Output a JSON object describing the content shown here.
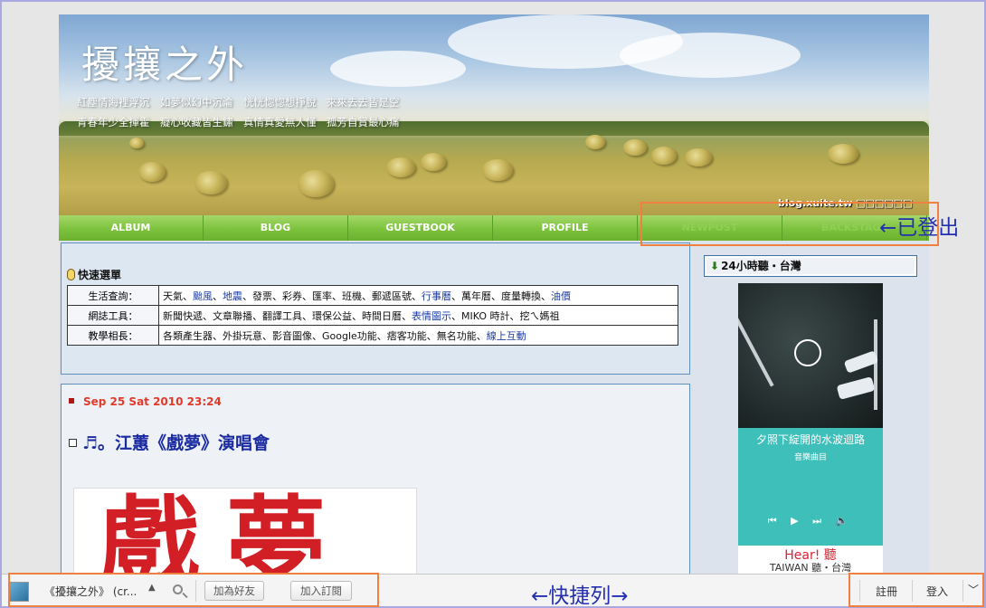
{
  "header": {
    "title": "擾攘之外",
    "tagline_1": "紅塵情海裡浮沉　如夢似幻中沉淪　恍恍惚惚想掙脫　來來去去皆是空",
    "tagline_2": "青春年少全揮霍　癡心收藏皆生鏽　真情真愛無人懂　孤芳自賞最心痛",
    "blog_url": "blog.xuite.tw □□□□□□"
  },
  "nav": {
    "items": [
      {
        "label": "ALBUM"
      },
      {
        "label": "BLOG"
      },
      {
        "label": "GUESTBOOK"
      },
      {
        "label": "PROFILE"
      },
      {
        "label": "NEWPOST"
      },
      {
        "label": "BACKSTAGE"
      }
    ]
  },
  "quick_menu": {
    "title": "快速選單",
    "rows": [
      {
        "category": "生活查詢：",
        "links": [
          {
            "text": "天氣",
            "link": false
          },
          {
            "text": "颱風",
            "link": true
          },
          {
            "text": "地震",
            "link": true
          },
          {
            "text": "發票",
            "link": false
          },
          {
            "text": "彩券",
            "link": false
          },
          {
            "text": "匯率",
            "link": false
          },
          {
            "text": "班機",
            "link": false
          },
          {
            "text": "郵遞區號",
            "link": false
          },
          {
            "text": "行事曆",
            "link": true
          },
          {
            "text": "萬年曆",
            "link": false
          },
          {
            "text": "度量轉換",
            "link": false
          },
          {
            "text": "油價",
            "link": true
          }
        ]
      },
      {
        "category": "網誌工具：",
        "links": [
          {
            "text": "新聞快遞",
            "link": false
          },
          {
            "text": "文章聯播",
            "link": false
          },
          {
            "text": "翻譯工具",
            "link": false
          },
          {
            "text": "環保公益",
            "link": false
          },
          {
            "text": "時間日曆",
            "link": false
          },
          {
            "text": "表情圖示",
            "link": true
          },
          {
            "text": "MIKO 時計",
            "link": false
          },
          {
            "text": "挖ㄟ媽祖",
            "link": false
          }
        ]
      },
      {
        "category": "教學相長：",
        "links": [
          {
            "text": "各類產生器",
            "link": false
          },
          {
            "text": "外掛玩意",
            "link": false
          },
          {
            "text": "影音圖像",
            "link": false
          },
          {
            "text": "Google功能",
            "link": false
          },
          {
            "text": "痞客功能",
            "link": false
          },
          {
            "text": "無名功能",
            "link": false
          },
          {
            "text": "線上互動",
            "link": true
          }
        ]
      }
    ]
  },
  "post": {
    "date": "Sep 25 Sat 2010 23:24",
    "title": "♬。江蕙《戲夢》演唱會",
    "image_text": "戲夢"
  },
  "sidebar": {
    "widget_title": "24小時聽・台灣",
    "player": {
      "song": "夕照下綻開的水波迴路",
      "subtitle": "音樂曲目",
      "controls": "⏮ ▶ ⏭ 🔈",
      "brand_top": "Hear! 聽",
      "brand_bottom": "TAIWAN 聽・台灣"
    }
  },
  "annotations": {
    "logged_out": "←已登出",
    "quick_bar": "←快捷列→"
  },
  "toolbar": {
    "blog_name": "《擾攘之外》 (cr...",
    "up_arrow": "▲",
    "add_friend": "加為好友",
    "subscribe": "加入訂閱",
    "register": "註冊",
    "login": "登入",
    "expand": "﹀"
  },
  "colors": {
    "accent_green": "#7cc23d",
    "date_red": "#e03a2a",
    "title_blue": "#1a2aa0",
    "annotation_orange": "#f08040",
    "annotation_blue": "#2430b0"
  }
}
